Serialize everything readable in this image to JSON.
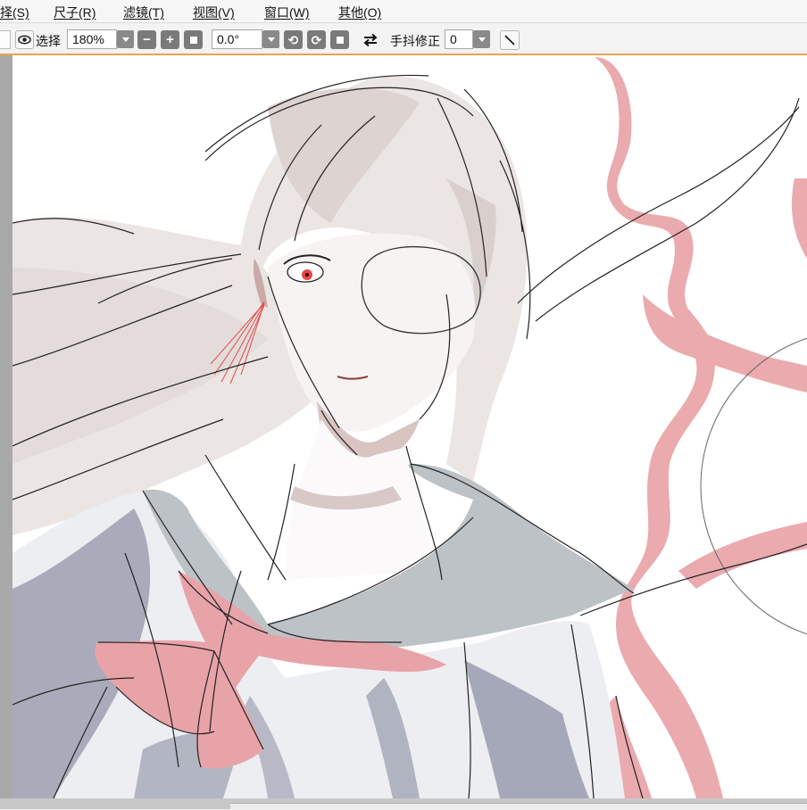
{
  "menubar": {
    "items": [
      "择(S)",
      "尺子(R)",
      "滤镜(T)",
      "视图(V)",
      "窗口(W)",
      "其他(O)"
    ]
  },
  "toolbar": {
    "select_label": "选择",
    "zoom_value": "180%",
    "rotation_value": "0.0°",
    "stabilizer_label": "手抖修正",
    "stabilizer_value": "0"
  },
  "colors": {
    "accent_orange": "#f0a050",
    "hair": "#e6dfdd",
    "uniform_blue": "#a9acbc",
    "collar_gray": "#bec3c7",
    "ribbon_pink": "#e8a2a8",
    "line_art": "#222222"
  }
}
